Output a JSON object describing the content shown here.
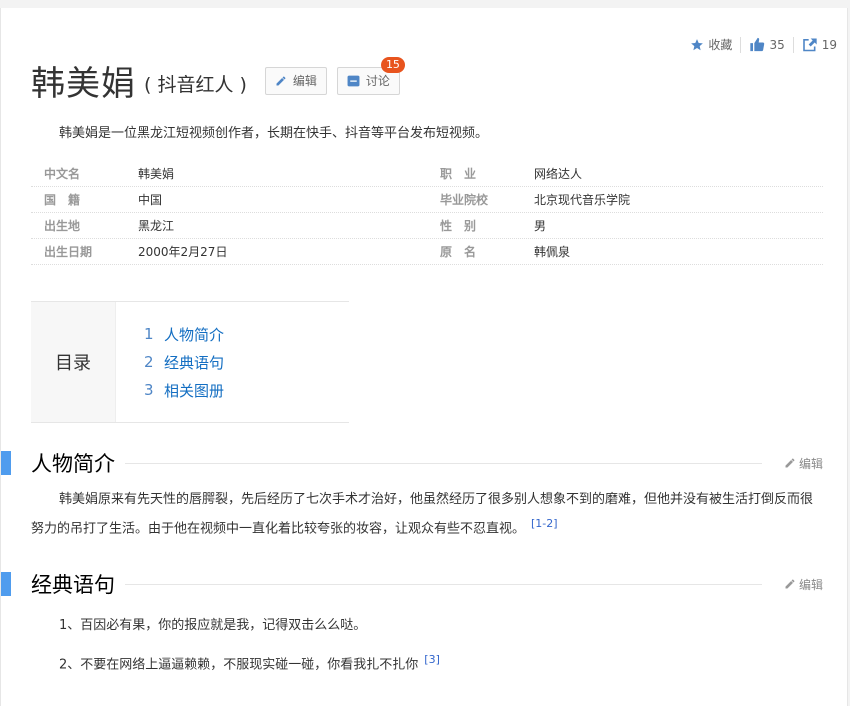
{
  "actions": {
    "collect_label": "收藏",
    "like_count": "35",
    "share_count": "19"
  },
  "header": {
    "title": "韩美娟",
    "subtitle": "( 抖音红人 )",
    "edit_label": "编辑",
    "discuss_label": "讨论",
    "discuss_badge": "15"
  },
  "summary": "韩美娟是一位黑龙江短视频创作者，长期在快手、抖音等平台发布短视频。",
  "info": {
    "rows": [
      [
        {
          "k": "中文名",
          "v": "韩美娟"
        },
        {
          "k": "职　业",
          "v": "网络达人"
        }
      ],
      [
        {
          "k": "国　籍",
          "v": "中国"
        },
        {
          "k": "毕业院校",
          "v": "北京现代音乐学院"
        }
      ],
      [
        {
          "k": "出生地",
          "v": "黑龙江"
        },
        {
          "k": "性　别",
          "v": "男"
        }
      ],
      [
        {
          "k": "出生日期",
          "v": "2000年2月27日"
        },
        {
          "k": "原　名",
          "v": "韩佩泉"
        }
      ]
    ]
  },
  "catalog": {
    "heading": "目录",
    "items": [
      {
        "num": "1",
        "label": "人物简介"
      },
      {
        "num": "2",
        "label": "经典语句"
      },
      {
        "num": "3",
        "label": "相关图册"
      }
    ]
  },
  "sections": {
    "intro": {
      "title": "人物简介",
      "edit_label": "编辑",
      "text": "韩美娟原来有先天性的唇腭裂，先后经历了七次手术才治好，他虽然经历了很多别人想象不到的磨难，但他并没有被生活打倒反而很努力的吊打了生活。由于他在视频中一直化着比较夸张的妆容，让观众有些不忍直视。",
      "ref": "[1-2]"
    },
    "quotes": {
      "title": "经典语句",
      "edit_label": "编辑",
      "line1": "1、百因必有果，你的报应就是我，记得双击么么哒。",
      "line2": "2、不要在网络上逼逼赖赖，不服现实碰一碰，你看我扎不扎你",
      "ref": "[3]"
    }
  },
  "colors": {
    "accent": "#4f9cee",
    "link": "#136ec2",
    "badge": "#e8541e"
  }
}
